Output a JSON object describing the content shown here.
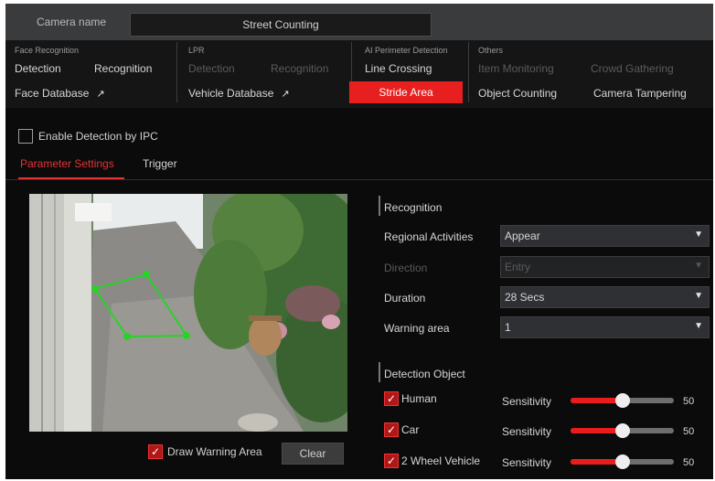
{
  "camera": {
    "label": "Camera name",
    "value": "Street Counting"
  },
  "menu": {
    "face": {
      "title": "Face Recognition",
      "items": [
        "Detection",
        "Recognition",
        "Face Database"
      ]
    },
    "lpr": {
      "title": "LPR",
      "items": [
        "Detection",
        "Recognition",
        "Vehicle Database"
      ]
    },
    "perimeter": {
      "title": "AI Perimeter Detection",
      "items": [
        "Line Crossing",
        "Stride Area"
      ]
    },
    "others": {
      "title": "Others",
      "items": [
        "Item Monitoring",
        "Crowd Gathering",
        "Object Counting",
        "Camera Tampering"
      ]
    },
    "active_item": "Stride Area",
    "active_color": "#e81f1f"
  },
  "enable_ipc": {
    "label": "Enable Detection by IPC",
    "checked": false
  },
  "tabs": [
    {
      "label": "Parameter Settings",
      "active": true
    },
    {
      "label": "Trigger",
      "active": false
    }
  ],
  "video": {
    "draw_warning_area": {
      "label": "Draw Warning Area",
      "checked": true
    },
    "clear_label": "Clear"
  },
  "recognition": {
    "title": "Recognition",
    "fields": [
      {
        "label": "Regional Activities",
        "value": "Appear",
        "disabled": false
      },
      {
        "label": "Direction",
        "value": "Entry",
        "disabled": true
      },
      {
        "label": "Duration",
        "value": "28 Secs",
        "disabled": false
      },
      {
        "label": "Warning area",
        "value": "1",
        "disabled": false
      }
    ]
  },
  "detection_object": {
    "title": "Detection Object",
    "sensitivity_label": "Sensitivity",
    "objects": [
      {
        "label": "Human",
        "checked": true,
        "sensitivity": 50
      },
      {
        "label": "Car",
        "checked": true,
        "sensitivity": 50
      },
      {
        "label": "2 Wheel Vehicle",
        "checked": true,
        "sensitivity": 50
      }
    ]
  }
}
